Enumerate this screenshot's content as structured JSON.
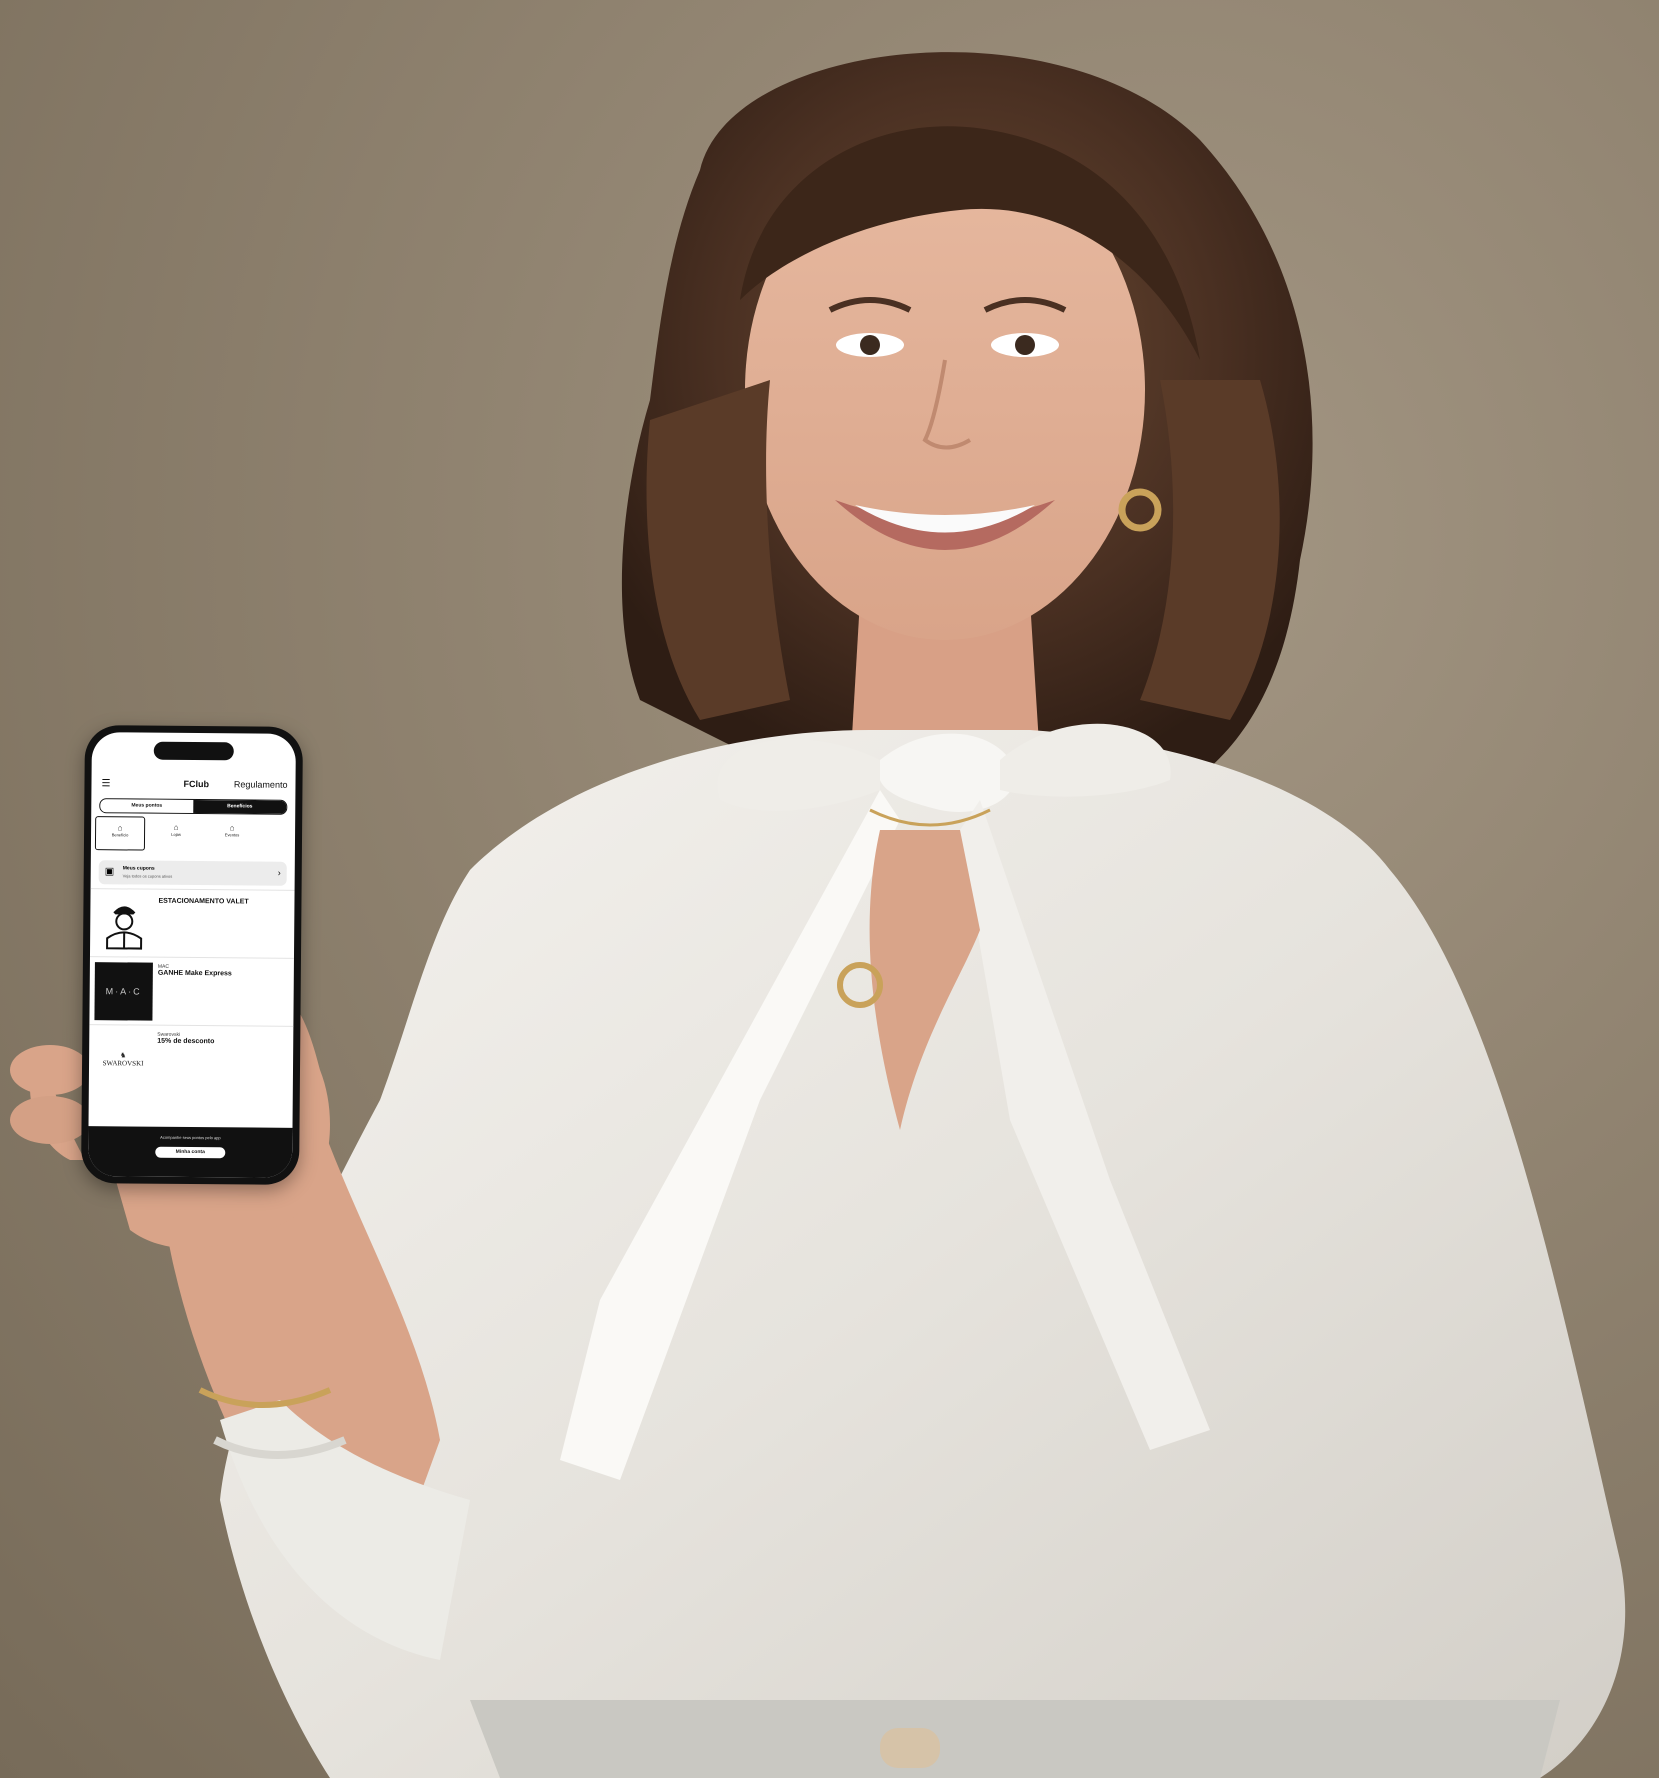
{
  "phone": {
    "header": {
      "title": "FClub",
      "rules_link": "Regulamento"
    },
    "toggle": {
      "left": "Meus pontos",
      "right": "Benefícios"
    },
    "categories": [
      "Benefício",
      "Lojas",
      "Eventos"
    ],
    "wallet": {
      "title": "Meus cupons",
      "subtitle": "Veja todos os cupons ativos"
    },
    "offers": [
      {
        "brand": "",
        "title": "ESTACIONAMENTO VALET"
      },
      {
        "brand": "MAC",
        "title": "GANHE Make Express"
      },
      {
        "brand": "Swarovski",
        "title": "15% de desconto"
      }
    ],
    "mac_logo": "M·A·C",
    "swarovski_logo": "SWAROVSKI",
    "footer": {
      "text": "Acompanhe seus pontos pelo app",
      "button": "Minha conta"
    }
  }
}
